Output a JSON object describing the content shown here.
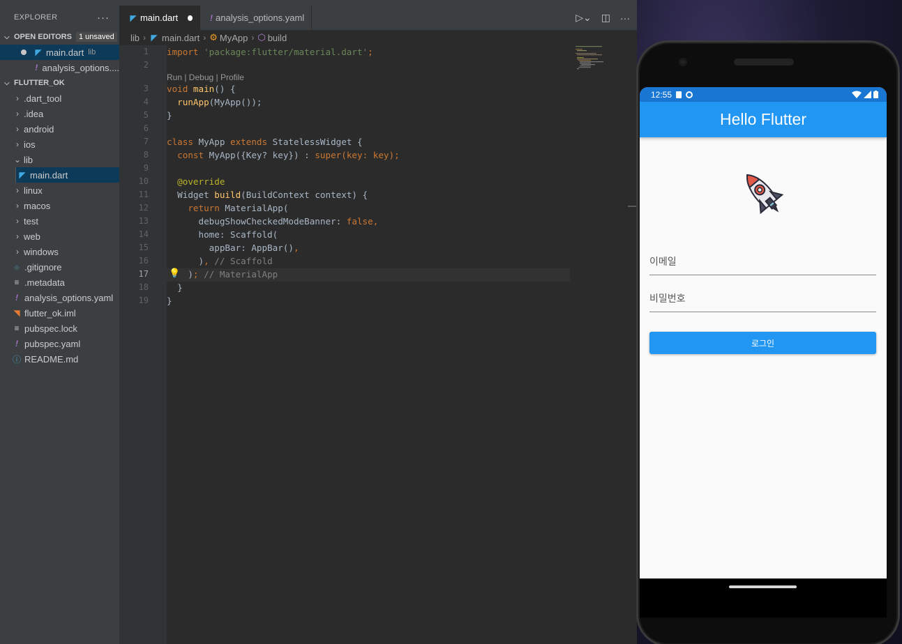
{
  "explorer": {
    "title": "EXPLORER",
    "more_label": "···",
    "open_editors": {
      "label": "OPEN EDITORS",
      "badge": "1 unsaved",
      "items": [
        {
          "name": "main.dart",
          "desc": "lib"
        },
        {
          "name": "analysis_options...."
        }
      ]
    },
    "project": {
      "label": "FLUTTER_OK",
      "items": [
        {
          "name": ".dart_tool"
        },
        {
          "name": ".idea"
        },
        {
          "name": "android"
        },
        {
          "name": "ios"
        },
        {
          "name": "lib"
        },
        {
          "name": "main.dart"
        },
        {
          "name": "linux"
        },
        {
          "name": "macos"
        },
        {
          "name": "test"
        },
        {
          "name": "web"
        },
        {
          "name": "windows"
        },
        {
          "name": ".gitignore"
        },
        {
          "name": ".metadata"
        },
        {
          "name": "analysis_options.yaml"
        },
        {
          "name": "flutter_ok.iml"
        },
        {
          "name": "pubspec.lock"
        },
        {
          "name": "pubspec.yaml"
        },
        {
          "name": "README.md"
        }
      ]
    }
  },
  "tabs": [
    {
      "label": "main.dart",
      "active": true,
      "unsaved": true
    },
    {
      "label": "analysis_options.yaml",
      "active": false
    }
  ],
  "breadcrumb": [
    "lib",
    "main.dart",
    "MyApp",
    "build"
  ],
  "editor": {
    "codelens": "Run | Debug | Profile",
    "line_numbers": [
      "1",
      "2",
      "3",
      "4",
      "5",
      "6",
      "7",
      "8",
      "9",
      "10",
      "11",
      "12",
      "13",
      "14",
      "15",
      "16",
      "17",
      "18",
      "19"
    ],
    "current_line": "17",
    "code": {
      "l1a": "import ",
      "l1b": "'package:flutter/material.dart'",
      "l1c": ";",
      "l3a": "void ",
      "l3b": "main",
      "l3c": "() {",
      "l4a": "  ",
      "l4b": "runApp",
      "l4c": "(MyApp());",
      "l5": "}",
      "l7a": "class ",
      "l7b": "MyApp ",
      "l7c": "extends ",
      "l7d": "StatelessWidget {",
      "l8a": "  ",
      "l8b": "const ",
      "l8c": "MyApp({Key? key}) : ",
      "l8d": "super",
      "l8e": "(key: key);",
      "l10": "  @override",
      "l11a": "  Widget ",
      "l11b": "build",
      "l11c": "(BuildContext context) {",
      "l12a": "    ",
      "l12b": "return ",
      "l12c": "MaterialApp(",
      "l13a": "      debugShowCheckedModeBanner: ",
      "l13b": "false",
      "l13c": ",",
      "l14": "      home: Scaffold(",
      "l15a": "        appBar: AppBar()",
      "l15b": ",",
      "l16a": "      )",
      "l16b": ", ",
      "l16c": "// Scaffold",
      "l17a": "    )",
      "l17b": "; ",
      "l17c": "// MaterialApp",
      "l18": "  }",
      "l19": "}"
    }
  },
  "phone": {
    "status_time": "12:55",
    "appbar_title": "Hello Flutter",
    "email_label": "이메일",
    "password_label": "비밀번호",
    "login_button": "로그인"
  },
  "colors": {
    "appbar": "#2196f3",
    "statusbar": "#1976d2",
    "selection": "#0d3a58"
  }
}
